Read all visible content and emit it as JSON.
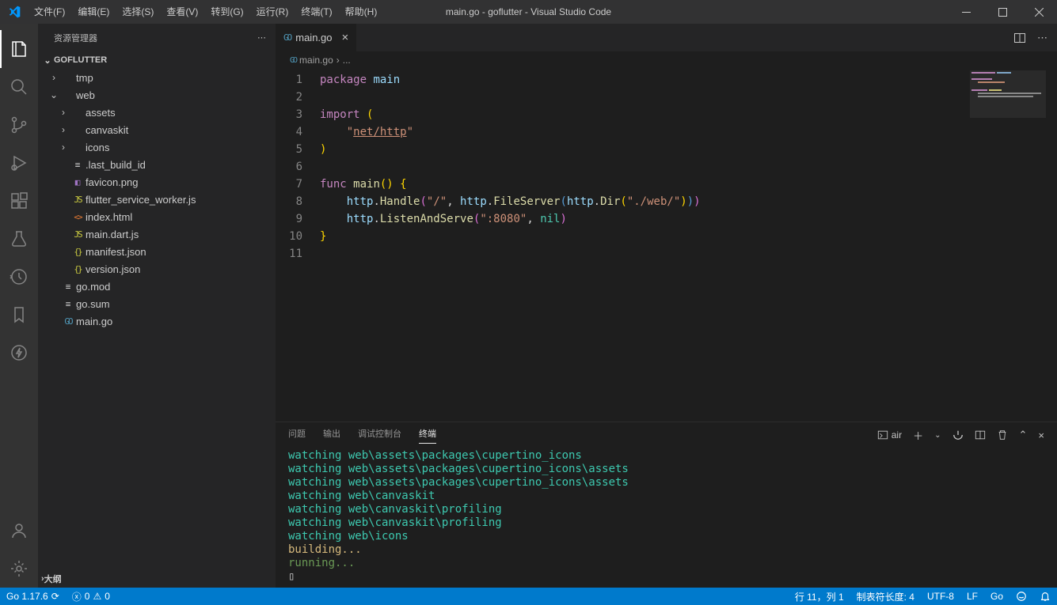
{
  "title": "main.go - goflutter - Visual Studio Code",
  "menus": [
    "文件(F)",
    "编辑(E)",
    "选择(S)",
    "查看(V)",
    "转到(G)",
    "运行(R)",
    "终端(T)",
    "帮助(H)"
  ],
  "sidebar": {
    "header": "资源管理器",
    "project": "GOFLUTTER",
    "outline": "大纲",
    "tree": [
      {
        "depth": 0,
        "tw": "›",
        "icon": "",
        "iconColor": "",
        "label": "tmp"
      },
      {
        "depth": 0,
        "tw": "⌄",
        "icon": "",
        "iconColor": "",
        "label": "web"
      },
      {
        "depth": 1,
        "tw": "›",
        "icon": "",
        "iconColor": "",
        "label": "assets"
      },
      {
        "depth": 1,
        "tw": "›",
        "icon": "",
        "iconColor": "",
        "label": "canvaskit"
      },
      {
        "depth": 1,
        "tw": "›",
        "icon": "",
        "iconColor": "",
        "label": "icons"
      },
      {
        "depth": 1,
        "tw": "",
        "icon": "≡",
        "iconColor": "#c5c5c5",
        "label": ".last_build_id"
      },
      {
        "depth": 1,
        "tw": "",
        "icon": "◧",
        "iconColor": "#a074c4",
        "label": "favicon.png"
      },
      {
        "depth": 1,
        "tw": "",
        "icon": "JS",
        "iconColor": "#cbcb41",
        "label": "flutter_service_worker.js"
      },
      {
        "depth": 1,
        "tw": "",
        "icon": "<>",
        "iconColor": "#e37933",
        "label": "index.html"
      },
      {
        "depth": 1,
        "tw": "",
        "icon": "JS",
        "iconColor": "#cbcb41",
        "label": "main.dart.js"
      },
      {
        "depth": 1,
        "tw": "",
        "icon": "{}",
        "iconColor": "#cbcb41",
        "label": "manifest.json"
      },
      {
        "depth": 1,
        "tw": "",
        "icon": "{}",
        "iconColor": "#cbcb41",
        "label": "version.json"
      },
      {
        "depth": 0,
        "tw": "",
        "icon": "≡",
        "iconColor": "#c5c5c5",
        "label": "go.mod"
      },
      {
        "depth": 0,
        "tw": "",
        "icon": "≡",
        "iconColor": "#c5c5c5",
        "label": "go.sum"
      },
      {
        "depth": 0,
        "tw": "",
        "icon": "GO",
        "iconColor": "#519aba",
        "label": "main.go"
      }
    ]
  },
  "tab": {
    "icon": "GO",
    "label": "main.go"
  },
  "breadcrumb": {
    "icon": "GO",
    "file": "main.go",
    "sep": "›",
    "more": "..."
  },
  "gutter": [
    "1",
    "2",
    "3",
    "4",
    "5",
    "6",
    "7",
    "8",
    "9",
    "10",
    "11"
  ],
  "code_lines": [
    [
      {
        "c": "tk-kw",
        "t": "package"
      },
      {
        "c": "tk-punc",
        "t": " "
      },
      {
        "c": "tk-id",
        "t": "main"
      }
    ],
    [],
    [
      {
        "c": "tk-kw",
        "t": "import"
      },
      {
        "c": "tk-punc",
        "t": " "
      },
      {
        "c": "tk-rainbow-y",
        "t": "("
      }
    ],
    [
      {
        "c": "tk-punc",
        "t": "    "
      },
      {
        "c": "tk-str",
        "t": "\""
      },
      {
        "c": "tk-strunder",
        "t": "net/http"
      },
      {
        "c": "tk-str",
        "t": "\""
      }
    ],
    [
      {
        "c": "tk-rainbow-y",
        "t": ")"
      }
    ],
    [],
    [
      {
        "c": "tk-kw",
        "t": "func"
      },
      {
        "c": "tk-punc",
        "t": " "
      },
      {
        "c": "tk-fn",
        "t": "main"
      },
      {
        "c": "tk-rainbow-y",
        "t": "()"
      },
      {
        "c": "tk-punc",
        "t": " "
      },
      {
        "c": "tk-rainbow-y",
        "t": "{"
      }
    ],
    [
      {
        "c": "tk-punc",
        "t": "    "
      },
      {
        "c": "tk-id",
        "t": "http"
      },
      {
        "c": "tk-punc",
        "t": "."
      },
      {
        "c": "tk-fn",
        "t": "Handle"
      },
      {
        "c": "tk-rainbow-p",
        "t": "("
      },
      {
        "c": "tk-str",
        "t": "\"/\""
      },
      {
        "c": "tk-punc",
        "t": ", "
      },
      {
        "c": "tk-id",
        "t": "http"
      },
      {
        "c": "tk-punc",
        "t": "."
      },
      {
        "c": "tk-fn",
        "t": "FileServer"
      },
      {
        "c": "tk-rainbow-b",
        "t": "("
      },
      {
        "c": "tk-id",
        "t": "http"
      },
      {
        "c": "tk-punc",
        "t": "."
      },
      {
        "c": "tk-fn",
        "t": "Dir"
      },
      {
        "c": "tk-rainbow-y",
        "t": "("
      },
      {
        "c": "tk-str",
        "t": "\"./web/\""
      },
      {
        "c": "tk-rainbow-y",
        "t": ")"
      },
      {
        "c": "tk-rainbow-b",
        "t": ")"
      },
      {
        "c": "tk-rainbow-p",
        "t": ")"
      }
    ],
    [
      {
        "c": "tk-punc",
        "t": "    "
      },
      {
        "c": "tk-id",
        "t": "http"
      },
      {
        "c": "tk-punc",
        "t": "."
      },
      {
        "c": "tk-fn",
        "t": "ListenAndServe"
      },
      {
        "c": "tk-rainbow-p",
        "t": "("
      },
      {
        "c": "tk-str",
        "t": "\":8080\""
      },
      {
        "c": "tk-punc",
        "t": ", "
      },
      {
        "c": "tk-ty",
        "t": "nil"
      },
      {
        "c": "tk-rainbow-p",
        "t": ")"
      }
    ],
    [
      {
        "c": "tk-rainbow-y",
        "t": "}"
      }
    ],
    []
  ],
  "panel": {
    "tabs": [
      "问题",
      "输出",
      "调试控制台",
      "终端"
    ],
    "active": 3,
    "profile": "air",
    "lines": [
      {
        "cls": "term-cyan",
        "t": "watching web\\assets\\packages\\cupertino_icons"
      },
      {
        "cls": "term-cyan",
        "t": "watching web\\assets\\packages\\cupertino_icons\\assets"
      },
      {
        "cls": "term-cyan",
        "t": "watching web\\assets\\packages\\cupertino_icons\\assets"
      },
      {
        "cls": "term-cyan",
        "t": "watching web\\canvaskit"
      },
      {
        "cls": "term-cyan",
        "t": "watching web\\canvaskit\\profiling"
      },
      {
        "cls": "term-cyan",
        "t": "watching web\\canvaskit\\profiling"
      },
      {
        "cls": "term-cyan",
        "t": "watching web\\icons"
      },
      {
        "cls": "term-yellow",
        "t": "building..."
      },
      {
        "cls": "term-green",
        "t": "running..."
      },
      {
        "cls": "",
        "t": "▯"
      }
    ]
  },
  "status": {
    "go": "Go 1.17.6",
    "errors": "0",
    "warnings": "0",
    "pos": "行 11，列 1",
    "tab": "制表符长度: 4",
    "enc": "UTF-8",
    "eol": "LF",
    "lang": "Go"
  }
}
